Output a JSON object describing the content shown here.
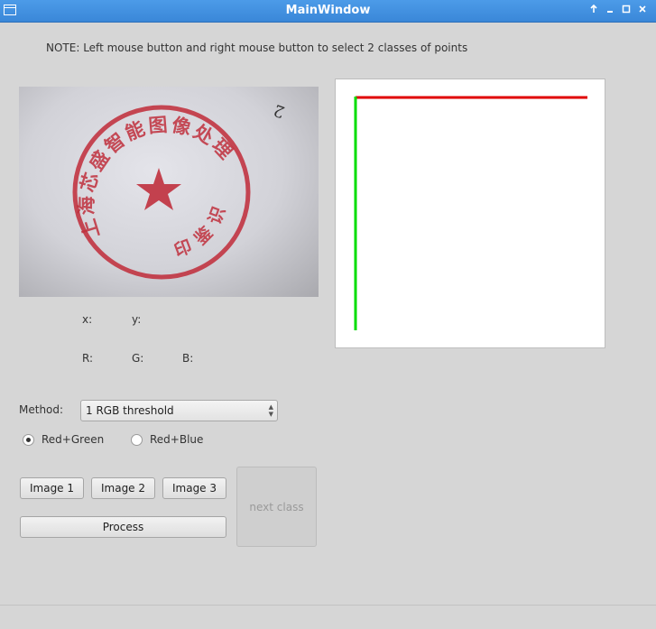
{
  "window": {
    "title": "MainWindow",
    "controls": [
      "pin-icon",
      "minimize-icon",
      "maximize-icon",
      "close-icon"
    ]
  },
  "note": "NOTE: Left mouse button  and right mouse button to select 2 classes of points",
  "photo": {
    "stamp_text": "上海芯盛智能图像处理",
    "stamp_bottom_text": "印 鉴 识 别",
    "corner_mark": "2"
  },
  "readouts": {
    "x_label": "x:",
    "y_label": "y:",
    "r_label": "R:",
    "g_label": "G:",
    "b_label": "B:"
  },
  "method": {
    "label": "Method:",
    "selected": "1 RGB threshold"
  },
  "radios": [
    {
      "label": "Red+Green",
      "checked": true
    },
    {
      "label": "Red+Blue",
      "checked": false
    }
  ],
  "buttons": {
    "image1": "Image 1",
    "image2": "Image 2",
    "image3": "Image 3",
    "process": "Process",
    "next_class": "next class"
  },
  "colors": {
    "titlebar": "#3a87d8",
    "axis_red": "#e00000",
    "axis_green": "#00dd00",
    "stamp": "#c0303d"
  }
}
